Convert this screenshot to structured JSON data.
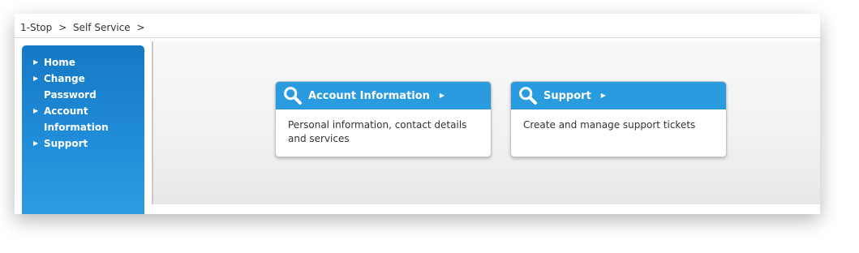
{
  "breadcrumb": {
    "items": [
      "1-Stop",
      "Self Service"
    ],
    "separator": ">"
  },
  "sidebar": {
    "items": [
      {
        "label": "Home"
      },
      {
        "label": "Change Password"
      },
      {
        "label": "Account Information"
      },
      {
        "label": "Support"
      }
    ],
    "arrow": "▶"
  },
  "cards": [
    {
      "title": "Account Information",
      "description": "Personal information, contact details and services",
      "icon": "search-icon",
      "arrow": "▶"
    },
    {
      "title": "Support",
      "description": "Create and manage support tickets",
      "icon": "search-icon",
      "arrow": "▶"
    }
  ],
  "colors": {
    "sidebar_blue": "#1f8ad6",
    "card_header_blue": "#2b9be0"
  }
}
